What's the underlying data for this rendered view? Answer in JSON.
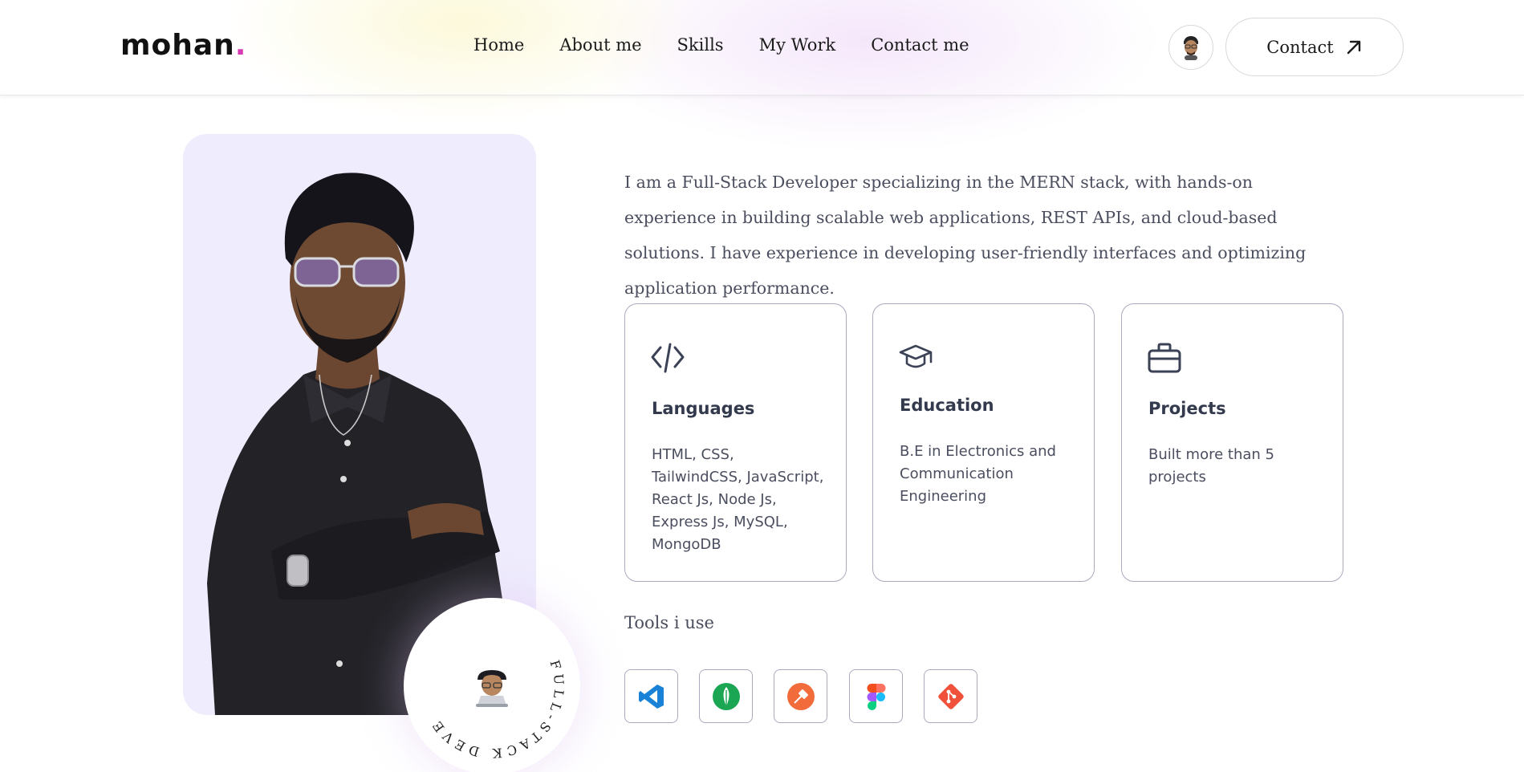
{
  "header": {
    "logo_text": "mohan",
    "logo_dot": ".",
    "nav": [
      "Home",
      "About me",
      "Skills",
      "My Work",
      "Contact me"
    ],
    "contact_label": "Contact"
  },
  "badge": {
    "circle_text": "FULL-STACK DEVELOPER"
  },
  "about": {
    "description": "I am a Full-Stack Developer specializing in the MERN stack, with hands-on experience in building scalable web applications, REST APIs, and cloud-based solutions. I have experience in developing user-friendly interfaces and optimizing application performance."
  },
  "cards": [
    {
      "icon": "code-icon",
      "title": "Languages",
      "body": "HTML, CSS, TailwindCSS, JavaScript, React Js, Node Js, Express Js, MySQL, MongoDB"
    },
    {
      "icon": "graduation-cap-icon",
      "title": "Education",
      "body": "B.E in Electronics and Communication Engineering"
    },
    {
      "icon": "briefcase-icon",
      "title": "Projects",
      "body": "Built more than 5 projects"
    }
  ],
  "tools": {
    "label": "Tools i use",
    "items": [
      "vscode-icon",
      "mongodb-icon",
      "postman-icon",
      "figma-icon",
      "git-icon"
    ]
  },
  "colors": {
    "accent": "#d63bb3",
    "card_border": "#a8abbd",
    "text": "#4a4e5e",
    "photo_bg": "#efecfd"
  }
}
